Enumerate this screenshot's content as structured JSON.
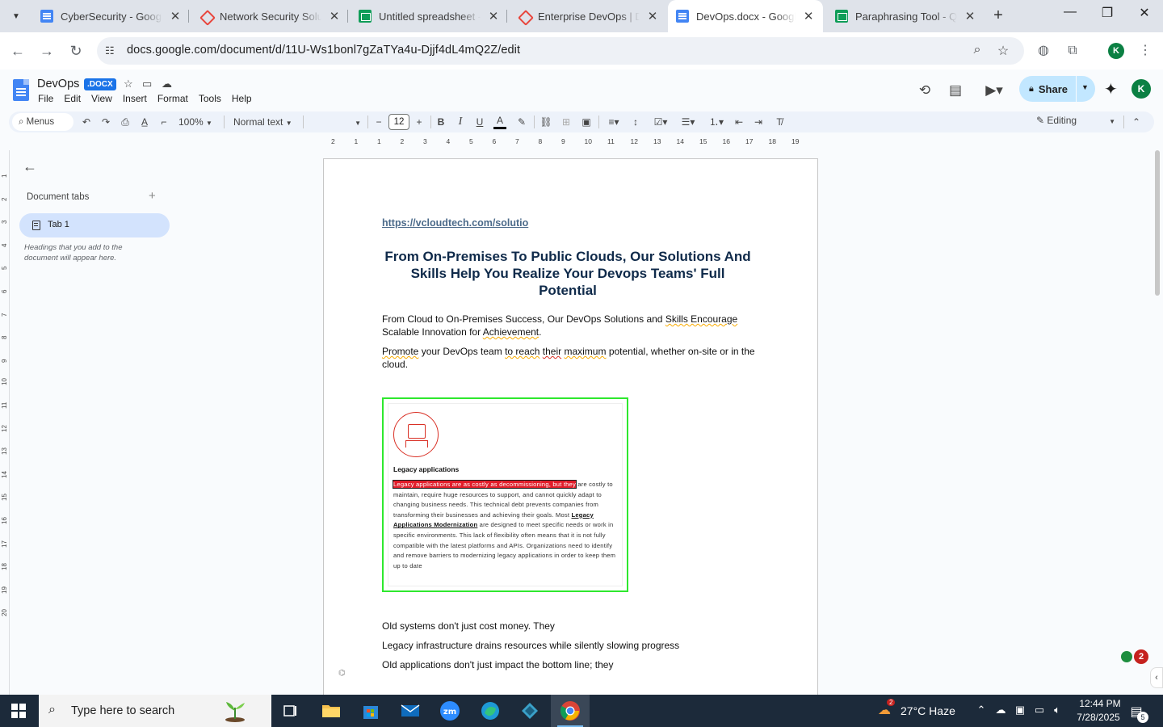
{
  "browser": {
    "tabs": [
      {
        "title": "CyberSecurity - Google",
        "icon": "docs-icon",
        "active": false
      },
      {
        "title": "Network Security Soluti",
        "icon": "diamond-icon",
        "active": false
      },
      {
        "title": "Untitled spreadsheet - G",
        "icon": "sheets-icon",
        "active": false
      },
      {
        "title": "Enterprise DevOps | Dev",
        "icon": "diamond-icon",
        "active": false
      },
      {
        "title": "DevOps.docx - Google D",
        "icon": "docs-icon",
        "active": true
      },
      {
        "title": "Paraphrasing Tool - Qui",
        "icon": "sheets-icon",
        "active": false
      }
    ],
    "url": "docs.google.com/document/d/11U-Ws1bonl7gZaTYa4u-Djjf4dL4mQ2Z/edit",
    "profile_initial": "K"
  },
  "docs": {
    "title": "DevOps",
    "badge": ".DOCX",
    "menu": [
      "File",
      "Edit",
      "View",
      "Insert",
      "Format",
      "Tools",
      "Help"
    ],
    "share_label": "Share",
    "profile_initial": "K",
    "toolbar": {
      "menus_label": "Menus",
      "zoom": "100%",
      "style": "Normal text",
      "font_size": "12",
      "mode": "Editing"
    },
    "sidebar": {
      "heading": "Document tabs",
      "tab_label": "Tab 1",
      "hint": "Headings that you add to the document will appear here."
    },
    "ruler_h": [
      "2",
      "1",
      "1",
      "2",
      "3",
      "4",
      "5",
      "6",
      "7",
      "8",
      "9",
      "10",
      "11",
      "12",
      "13",
      "14",
      "15",
      "16",
      "17",
      "18",
      "19"
    ],
    "ruler_v": [
      "1",
      "2",
      "3",
      "4",
      "5",
      "6",
      "7",
      "8",
      "9",
      "10",
      "11",
      "12",
      "13",
      "14",
      "15",
      "16",
      "17",
      "18",
      "19",
      "20"
    ]
  },
  "document": {
    "link": "https://vcloudtech.com/solutio",
    "heading": "From On-Premises To Public Clouds, Our Solutions And Skills Help You Realize Your Devops Teams' Full Potential",
    "para1": {
      "a": "From Cloud to On-Premises Success, Our DevOps Solutions and ",
      "b": "Skills Encourage",
      "c": " Scalable Innovation for ",
      "d": "Achievement",
      "e": "."
    },
    "para2": {
      "a": "Promote",
      "b": " your DevOps team ",
      "c": "to reach",
      "d": " ",
      "e": "their",
      "f": " ",
      "g": "maximum",
      "h": " potential, whether on-site or in the cloud."
    },
    "embed": {
      "heading": "Legacy applications",
      "highlight": "Legacy applications are as costly as decommissioning, but they",
      "text1": " are costly to maintain, require huge resources to support, and cannot quickly adapt to changing business needs. This technical debt prevents companies from transforming their businesses and achieving their goals. Most ",
      "link": "Legacy Applications Modernization",
      "text2": " are designed to meet specific needs or work in specific environments. This lack of flexibility often means that it is not fully compatible with the latest platforms and APIs. Organizations need to identify and remove barriers to modernizing legacy applications in order to keep them up to date"
    },
    "lines": [
      "Old systems don't just cost money. They",
      "Legacy infrastructure drains resources while silently slowing progress",
      "Old applications don't just impact the bottom line; they"
    ]
  },
  "notifications": {
    "count": "2"
  },
  "taskbar": {
    "search_placeholder": "Type here to search",
    "weather": "27°C  Haze",
    "weather_badge": "2",
    "time": "12:44 PM",
    "date": "7/28/2025",
    "notif_count": "5"
  }
}
